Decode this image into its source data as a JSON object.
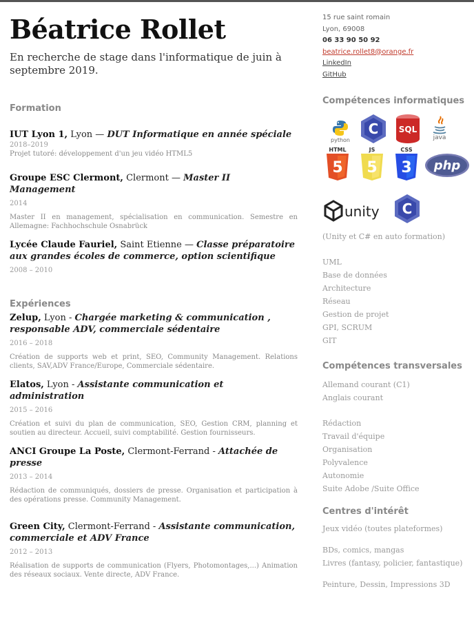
{
  "header": {
    "name": "Béatrice Rollet",
    "tagline": "En recherche de stage dans l'informatique de juin à septembre 2019."
  },
  "contact": {
    "address": "15 rue saint romain",
    "city": "Lyon, 69008",
    "phone": "06 33 90 50 92",
    "email": "beatrice.rollet8@orange.fr",
    "linkedin": "LinkedIn",
    "github": "GitHub"
  },
  "formation": {
    "title": "Formation",
    "entries": [
      {
        "org": "IUT Lyon 1,",
        "place": " Lyon — ",
        "role": "DUT Informatique en année spéciale",
        "date": "2018–2019",
        "desc": "Projet tutoré: développement d'un jeu vidéo HTML5"
      },
      {
        "org": "Groupe ESC Clermont,",
        "place": " Clermont — ",
        "role": "Master II Management",
        "date": "2014",
        "desc": "Master II en management, spécialisation en communication. Semestre en Allemagne: Fachhochschule Osnabrück"
      },
      {
        "org": "Lycée Claude Fauriel,",
        "place": " Saint Etienne — ",
        "role": "Classe préparatoire aux grandes écoles de commerce, option scientifique",
        "date": "2008 – 2010",
        "desc": ""
      }
    ]
  },
  "experiences": {
    "title": "Expériences",
    "entries": [
      {
        "org": "Zelup,",
        "place": " Lyon - ",
        "role": "Chargée marketing & communication , responsable ADV, commerciale sédentaire",
        "date": "2016 – 2018",
        "desc": "Création de supports web et print, SEO, Community Management. Relations clients, SAV,ADV France/Europe, Commerciale sédentaire."
      },
      {
        "org": "Elatos,",
        "place": " Lyon - ",
        "role": "Assistante communication et administration",
        "date": "2015 – 2016",
        "desc": "Création et suivi du plan de communication, SEO, Gestion CRM, planning et soutien au directeur. Accueil, suivi comptabilité. Gestion fournisseurs."
      },
      {
        "org": "ANCI Groupe La Poste,",
        "place": " Clermont-Ferrand - ",
        "role": "Attachée de presse",
        "date": "2013 – 2014",
        "desc": "Rédaction de communiqués, dossiers de presse. Organisation et participation à des opérations presse. Community Management."
      },
      {
        "org": "Green City,",
        "place": " Clermont-Ferrand - ",
        "role": "Assistante communication, commerciale et ADV France",
        "date": "2012 – 2013",
        "desc": "Réalisation de supports de communication (Flyers, Photomontages,...) Animation des réseaux sociaux. Vente directe, ADV France."
      }
    ]
  },
  "it_skills": {
    "title": "Compétences informatiques",
    "icons": {
      "python": "python",
      "c": "C",
      "sql": "SQL",
      "java": "java",
      "html": "HTML",
      "html_num": "5",
      "js": "JS",
      "js_num": "5",
      "css": "CSS",
      "css_num": "3",
      "php": "php",
      "unity": "unity",
      "csharp": "C"
    },
    "note": "(Unity et C# en auto formation)",
    "list": [
      "UML",
      "Base de données",
      "Architecture",
      "Réseau",
      "Gestion de projet",
      "GPI, SCRUM",
      "GIT"
    ]
  },
  "transversal": {
    "title": "Compétences transversales",
    "languages": [
      "Allemand courant (C1)",
      "Anglais courant"
    ],
    "list": [
      "Rédaction",
      "Travail d'équipe",
      "Organisation",
      "Polyvalence",
      "Autonomie",
      "Suite Adobe /Suite Office"
    ]
  },
  "interests": {
    "title": "Centres d'intérêt",
    "items": [
      "Jeux vidéo (toutes plateformes)",
      "BDs, comics, mangas",
      "Livres (fantasy, policier, fantastique)",
      "Peinture, Dessin, Impressions 3D"
    ]
  },
  "colors": {
    "html5": "#e34f26",
    "js": "#f0db4f",
    "css3": "#264de4",
    "php": "#777bb3",
    "c_blue": "#5c6bc0",
    "python_blue": "#3776ab",
    "sql_red": "#cc2927"
  }
}
